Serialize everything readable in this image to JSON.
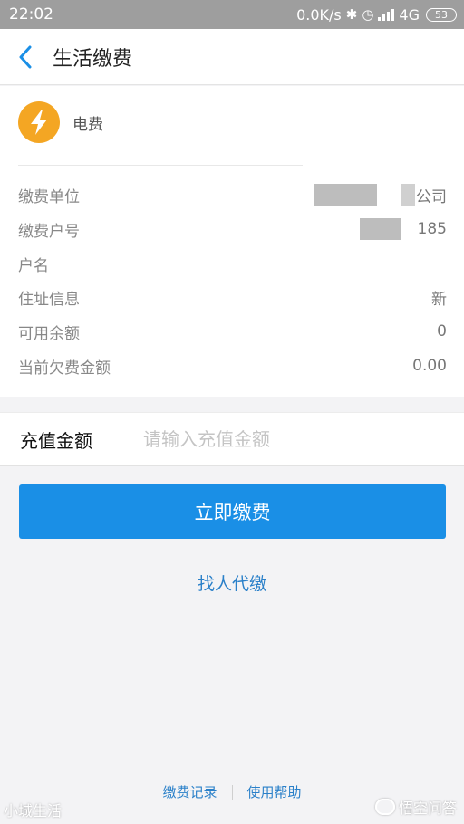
{
  "status_bar": {
    "time": "22:02",
    "net_speed": "0.0K/s",
    "network": "4G",
    "battery": "53"
  },
  "header": {
    "title": "生活缴费"
  },
  "biller": {
    "name": "电费",
    "icon": "lightning-bolt-icon",
    "icon_color": "#f4a623"
  },
  "info": {
    "rows": [
      {
        "label": "缴费单位",
        "value": "公司"
      },
      {
        "label": "缴费户号",
        "value": "185"
      },
      {
        "label": "户名",
        "value": ""
      },
      {
        "label": "住址信息",
        "value": "新"
      },
      {
        "label": "可用余额",
        "value": "0"
      },
      {
        "label": "当前欠费金额",
        "value": "0.00"
      }
    ]
  },
  "amount": {
    "label": "充值金额",
    "placeholder": "请输入充值金额"
  },
  "actions": {
    "pay_label": "立即缴费",
    "proxy_label": "找人代缴"
  },
  "footer": {
    "records_label": "缴费记录",
    "help_label": "使用帮助"
  },
  "watermarks": {
    "left": "小城生活",
    "right": "悟空问答"
  },
  "colors": {
    "primary": "#1a8fe6",
    "link": "#2a80c9",
    "background": "#f3f3f5"
  }
}
